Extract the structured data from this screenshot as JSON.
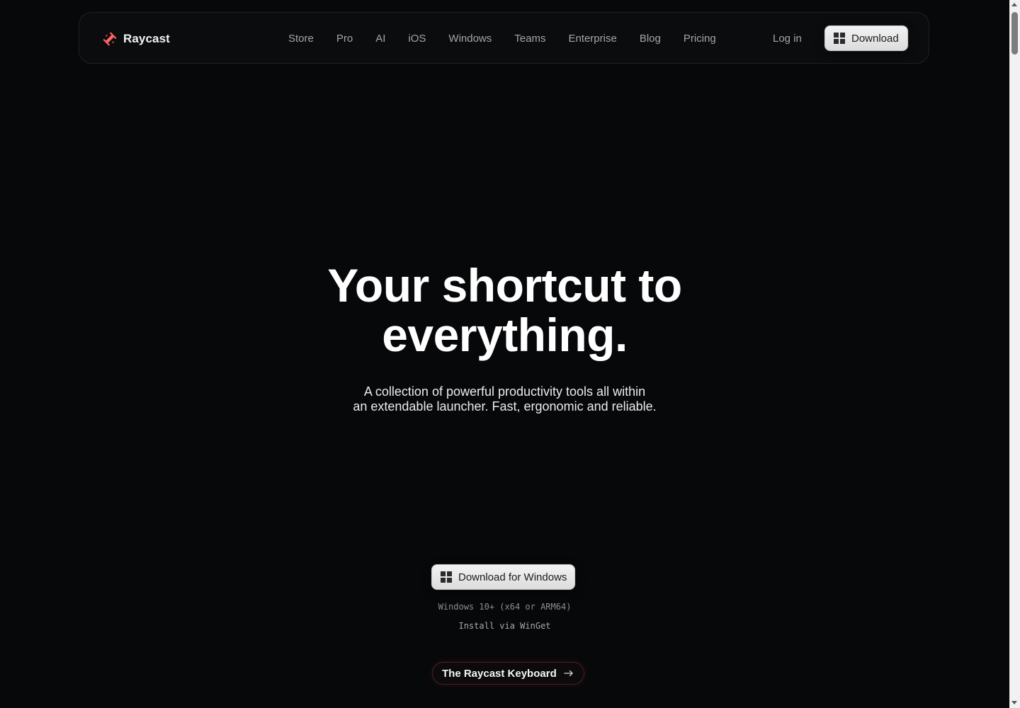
{
  "header": {
    "brand_name": "Raycast",
    "nav_items": [
      {
        "label": "Store"
      },
      {
        "label": "Pro"
      },
      {
        "label": "AI"
      },
      {
        "label": "iOS"
      },
      {
        "label": "Windows"
      },
      {
        "label": "Teams"
      },
      {
        "label": "Enterprise"
      },
      {
        "label": "Blog"
      },
      {
        "label": "Pricing"
      }
    ],
    "login_label": "Log in",
    "download_label": "Download"
  },
  "hero": {
    "title_line1": "Your shortcut to",
    "title_line2": "everything.",
    "subtitle_line1": "A collection of powerful productivity tools all within",
    "subtitle_line2": "an extendable launcher. Fast, ergonomic and reliable.",
    "download_label": "Download for Windows",
    "requirements": "Windows 10+ (x64 or ARM64)",
    "install_link": "Install via WinGet",
    "keyboard_label": "The Raycast Keyboard"
  },
  "icons": {
    "brand": "raycast-logo-icon",
    "download": "windows-icon",
    "keyboard_arrow": "arrow-right-icon"
  },
  "colors": {
    "background": "#07080a",
    "brand_red": "#ff6363",
    "nav_text": "#a5a6aa",
    "button_bg": "#f3f3f3"
  }
}
